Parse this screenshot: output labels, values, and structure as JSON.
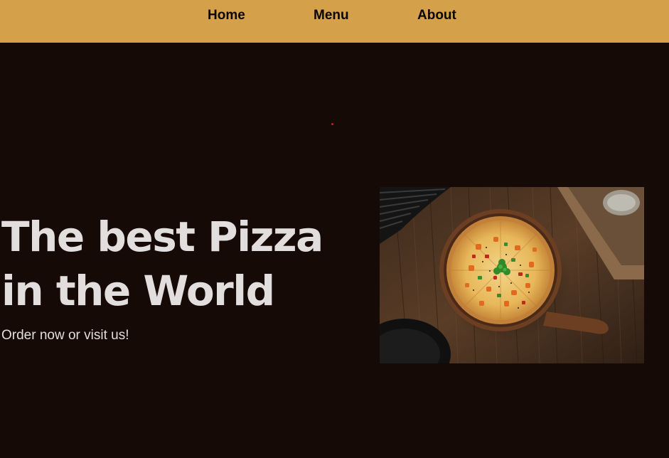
{
  "nav": {
    "items": [
      {
        "label": "Home"
      },
      {
        "label": "Menu"
      },
      {
        "label": "About"
      }
    ]
  },
  "hero": {
    "title_line1": "The best Pizza",
    "title_line2": "in the World",
    "subtitle": "Order now or visit us!",
    "image_alt": "pizza-on-wooden-board"
  },
  "colors": {
    "nav_background": "#d4a04a",
    "page_background": "#150a06",
    "hero_text": "#e2dede",
    "nav_text": "#0a0503"
  }
}
